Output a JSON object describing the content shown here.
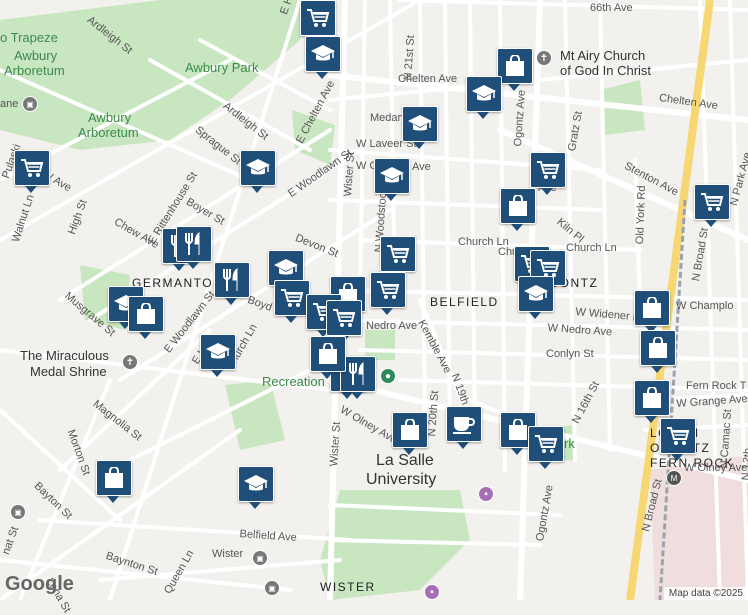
{
  "attribution": "Map data ©2025",
  "logo": "Google",
  "neighborhood_labels": {
    "belfield": "BELFIELD",
    "wister": "WISTER",
    "germantown": "GERMANTO",
    "ogontz": "OGONTZ",
    "logan": "LOGAN",
    "ogontz2": "OGONTZ",
    "fern_rock": "FERN ROCK"
  },
  "places": {
    "trapeze": "o Trapeze",
    "awbury_arboretum_1a": "Awbury",
    "awbury_arboretum_1b": "Arboretum",
    "awbury_park": "Awbury Park",
    "awbury_arboretum_2a": "Awbury",
    "awbury_arboretum_2b": "Arboretum",
    "church_a": "Mt Airy Church",
    "church_b": "of God In Christ",
    "shrine_a": "The Miraculous",
    "shrine_b": "Medal Shrine",
    "recreation": "Recreation",
    "lasalle_a": "La Salle",
    "lasalle_b": "University",
    "park_partial": "rk"
  },
  "streets": {
    "s1": "Ardleigh St",
    "s2": "E Ha",
    "s3": "66th Ave",
    "s4": "N 21st St",
    "s5": "Chelten Ave",
    "s6": "E Chelten Ave",
    "s7": "Chelten Ave",
    "s8": "Medary Ave",
    "s9": "Ardleigh St",
    "s10": "Sprague St",
    "s11": "W Laveer St",
    "s12": "W O",
    "s13": "Ave",
    "s14": "Ogontz Ave",
    "s15": "Gratz St",
    "s16": "Stenton Ave",
    "s17": "E Woodlawn St",
    "s18": "Wister St",
    "s19": "N Woodstock St",
    "s20": "Kiln Pl",
    "s21": "Church Ln",
    "s22": "Church Ln",
    "s23": "Old York Rd",
    "s24": "N Park Ave",
    "s25": "N Broad St",
    "s26": "E Rittenhouse St",
    "s27": "Boyer St",
    "s28": "Chew Ave",
    "s29": "High St",
    "s30": "Devon St",
    "s31": "Musgrave St",
    "s32": "E Woodlawn St",
    "s33": "Church Ln",
    "s34": "Nedro Ave",
    "s35": "Kemble Ave",
    "s36": "W Widener Pl",
    "s37": "W Champlo",
    "s38": "W Nedro Ave",
    "s39": "Conlyn St",
    "s40": "Fern Rock T",
    "s41": "W Grange Ave",
    "s42": "Magnolia St",
    "s43": "Morton St",
    "s44": "W Olney Ave",
    "s45": "N 20th St",
    "s46": "N 19th",
    "s47": "N 16th St",
    "s48": "Wister St",
    "s49": "Bayton St",
    "s50": "Belfield Ave",
    "s51": "Wister",
    "s52": "Baynton St",
    "s53": "Queen Ln",
    "s54": "Lena St",
    "s55": "W Olney Ave",
    "s56": "N Camac St",
    "s57": "N 12th",
    "s58": "Ogontz Ave",
    "s59": "N Broad St",
    "s60": "E Lo",
    "s61": "Boyd St",
    "s62": "Walnut Ln",
    "s63": "Chew Ave",
    "s64": "W Ave",
    "s65": "ane",
    "s66": "Pulaski",
    "s67": "Ave",
    "s68": "Church Ln",
    "s69": "nat St",
    "s70": "W"
  },
  "markers": [
    {
      "kind": "shopping-cart"
    },
    {
      "kind": "graduation-cap"
    },
    {
      "kind": "shopping-bag"
    },
    {
      "kind": "graduation-cap"
    },
    {
      "kind": "graduation-cap"
    },
    {
      "kind": "shopping-cart"
    },
    {
      "kind": "graduation-cap"
    },
    {
      "kind": "graduation-cap"
    },
    {
      "kind": "shopping-cart"
    },
    {
      "kind": "shopping-bag"
    },
    {
      "kind": "shopping-cart"
    },
    {
      "kind": "restaurant"
    },
    {
      "kind": "restaurant"
    },
    {
      "kind": "graduation-cap"
    },
    {
      "kind": "restaurant"
    },
    {
      "kind": "shopping-cart"
    },
    {
      "kind": "shopping-cart"
    },
    {
      "kind": "shopping-bag"
    },
    {
      "kind": "shopping-cart"
    },
    {
      "kind": "shopping-cart"
    },
    {
      "kind": "shopping-cart"
    },
    {
      "kind": "shopping-cart"
    },
    {
      "kind": "graduation-cap"
    },
    {
      "kind": "shopping-bag"
    },
    {
      "kind": "shopping-cart"
    },
    {
      "kind": "graduation-cap"
    },
    {
      "kind": "shopping-bag"
    },
    {
      "kind": "shopping-bag"
    },
    {
      "kind": "restaurant"
    },
    {
      "kind": "restaurant"
    },
    {
      "kind": "shopping-bag"
    },
    {
      "kind": "coffee-cup"
    },
    {
      "kind": "shopping-bag"
    },
    {
      "kind": "shopping-bag"
    },
    {
      "kind": "shopping-cart"
    },
    {
      "kind": "shopping-bag"
    },
    {
      "kind": "shopping-cart"
    },
    {
      "kind": "graduation-cap"
    },
    {
      "kind": "shopping-bag"
    },
    {
      "kind": "graduation-cap"
    }
  ],
  "colors": {
    "marker": "#1f4e79",
    "park": "#c8e6c0",
    "road": "#ffffff",
    "highway": "#f7d774",
    "rail": "#9aa3ad",
    "campus": "#f0dede"
  }
}
